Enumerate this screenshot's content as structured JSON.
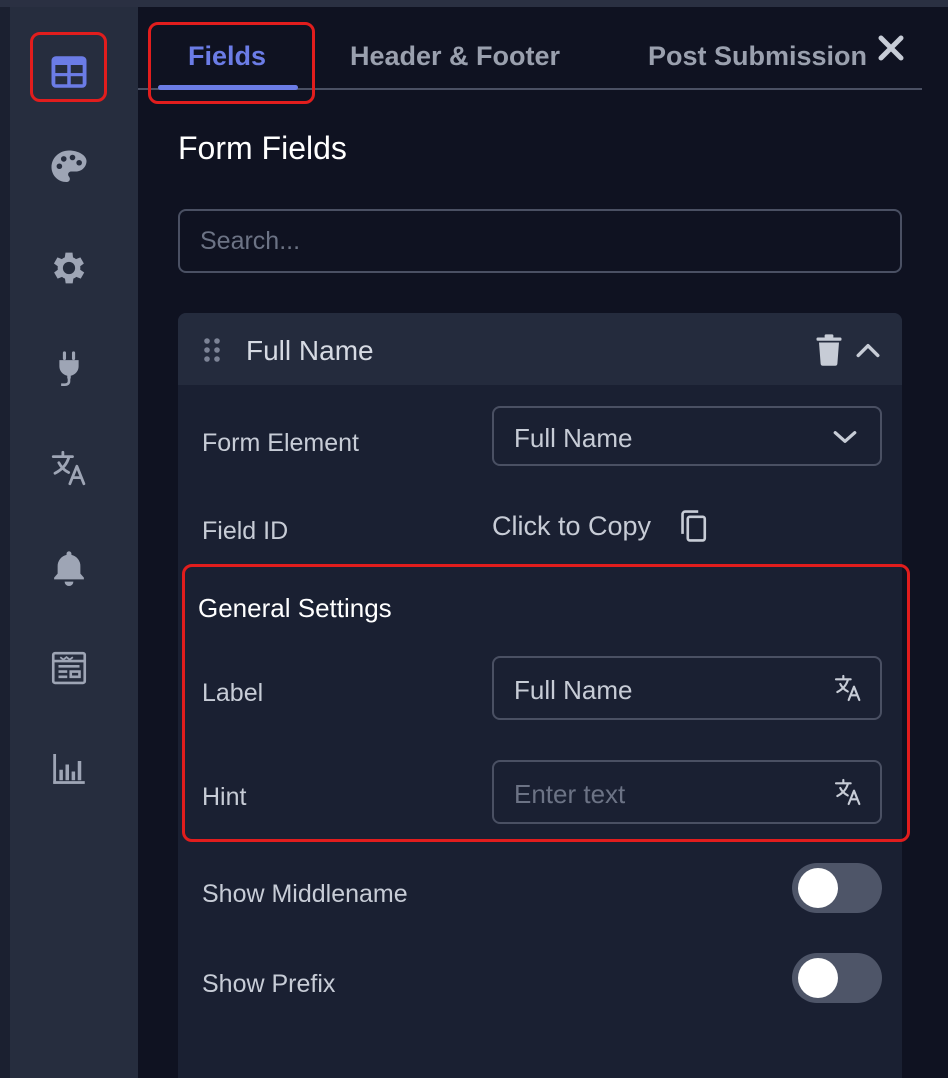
{
  "colors": {
    "accent": "#6b7ce6",
    "highlight": "#e11d1d",
    "background": "#0f1221",
    "sidebar": "#262d3e",
    "card": "#1a2032"
  },
  "sidebar": {
    "items": [
      {
        "icon": "table-layout-icon",
        "active": true
      },
      {
        "icon": "palette-icon",
        "active": false
      },
      {
        "icon": "gear-icon",
        "active": false
      },
      {
        "icon": "plug-icon",
        "active": false
      },
      {
        "icon": "translate-icon",
        "active": false
      },
      {
        "icon": "bell-icon",
        "active": false
      },
      {
        "icon": "newspaper-icon",
        "active": false
      },
      {
        "icon": "bar-chart-icon",
        "active": false
      }
    ]
  },
  "tabs": [
    {
      "label": "Fields",
      "active": true
    },
    {
      "label": "Header & Footer",
      "active": false
    },
    {
      "label": "Post Submission",
      "active": false
    }
  ],
  "section_title": "Form Fields",
  "search": {
    "placeholder": "Search...",
    "value": ""
  },
  "field_card": {
    "title": "Full Name",
    "form_element": {
      "label": "Form Element",
      "value": "Full Name"
    },
    "field_id": {
      "label": "Field ID",
      "action": "Click to Copy"
    },
    "general_settings": {
      "title": "General Settings",
      "label_field": {
        "label": "Label",
        "value": "Full Name"
      },
      "hint_field": {
        "label": "Hint",
        "placeholder": "Enter text"
      }
    },
    "toggles": [
      {
        "label": "Show Middlename",
        "on": false
      },
      {
        "label": "Show Prefix",
        "on": false
      }
    ]
  }
}
